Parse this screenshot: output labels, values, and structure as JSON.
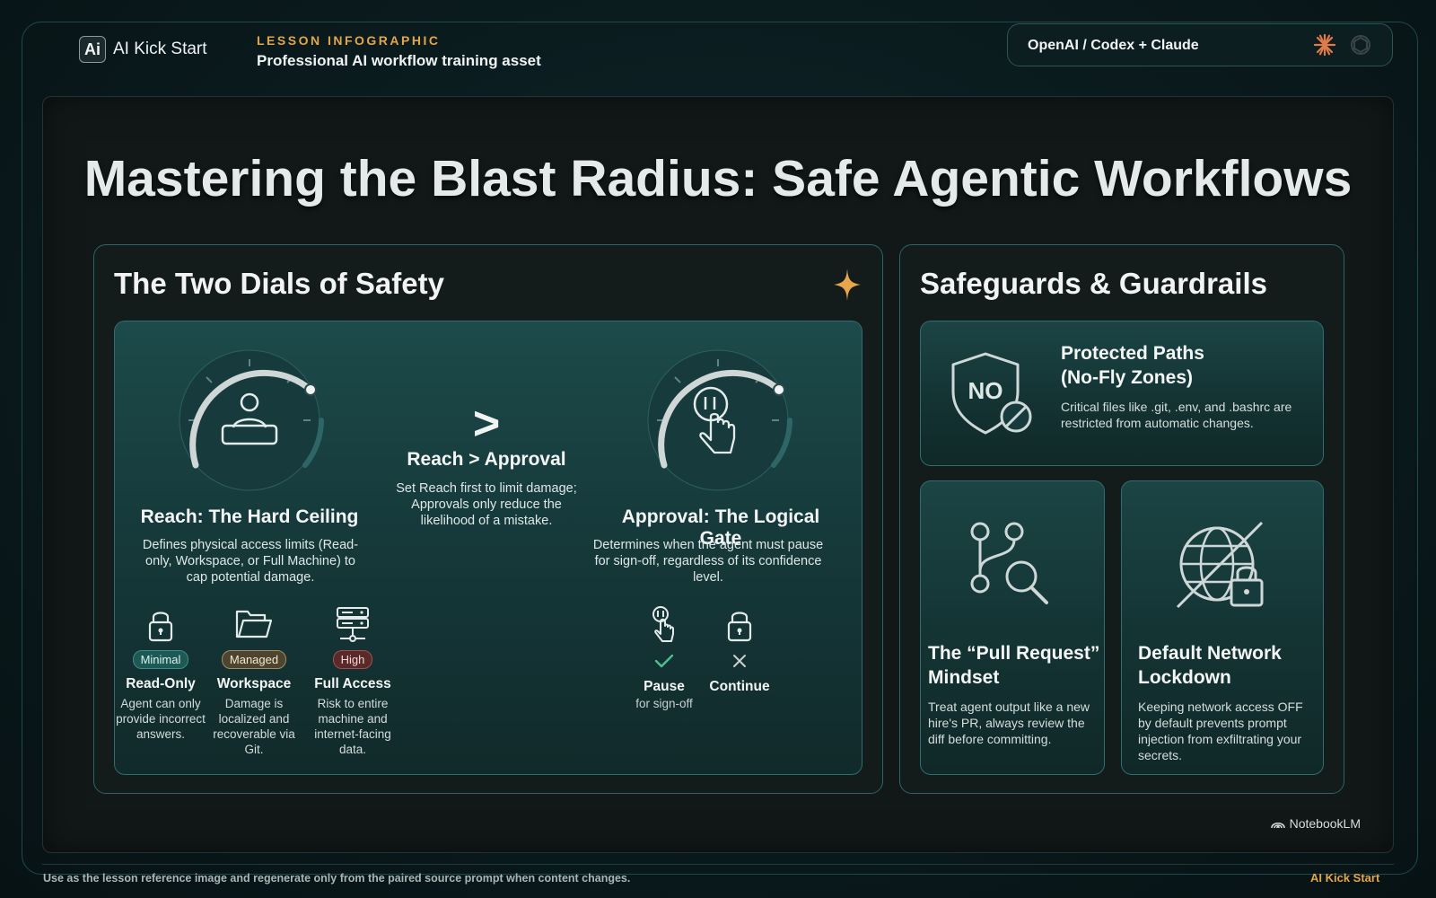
{
  "header": {
    "logo_mark": "Ai",
    "logo_text": "AI Kick Start",
    "kicker": "LESSON INFOGRAPHIC",
    "subtitle": "Professional AI workflow training asset",
    "model_pill": "OpenAI / Codex + Claude",
    "model_icons": [
      "claude-asterisk-icon",
      "openai-icon"
    ]
  },
  "title": "Mastering the Blast Radius: Safe Agentic Workflows",
  "dials_panel": {
    "title": "The Two Dials of Safety",
    "reach": {
      "title": "Reach: The Hard Ceiling",
      "description": "Defines physical access limits (Read-only, Workspace, or Full Machine) to cap potential damage."
    },
    "comparison": {
      "symbol": ">",
      "title": "Reach > Approval",
      "description": "Set Reach first to limit damage; Approvals only reduce the likelihood of a mistake."
    },
    "approval": {
      "title": "Approval: The Logical Gate",
      "description": "Determines when the agent must pause for sign-off, regardless of its confidence level."
    },
    "levels": [
      {
        "badge": "Minimal",
        "name": "Read-Only",
        "description": "Agent can only provide incorrect answers."
      },
      {
        "badge": "Managed",
        "name": "Workspace",
        "description": "Damage is localized and recoverable via Git."
      },
      {
        "badge": "High",
        "name": "Full Access",
        "description": "Risk to entire machine and internet-facing data."
      }
    ],
    "gates": [
      {
        "name": "Pause",
        "sub": "for sign-off"
      },
      {
        "name": "Continue",
        "sub": ""
      }
    ]
  },
  "guard_panel": {
    "title": "Safeguards & Guardrails",
    "protected": {
      "title_line1": "Protected Paths",
      "title_line2": "(No-Fly Zones)",
      "shield_text": "NO",
      "description": "Critical files like .git, .env, and .bashrc are restricted from automatic changes."
    },
    "pull_request": {
      "title_line1": "The “Pull Request”",
      "title_line2": "Mindset",
      "description": "Treat agent output like a new hire's PR, always review the diff before committing."
    },
    "network": {
      "title_line1": "Default Network",
      "title_line2": "Lockdown",
      "description": "Keeping network access OFF by default prevents prompt injection from exfiltrating your secrets."
    }
  },
  "watermark": "NotebookLM",
  "footer": {
    "note": "Use as the lesson reference image and regenerate only from the paired source prompt when content changes.",
    "brand": "AI Kick Start"
  },
  "colors": {
    "accent_orange": "#e3a54a",
    "teal_border": "#2a6567",
    "background": "#0a1a1d"
  }
}
